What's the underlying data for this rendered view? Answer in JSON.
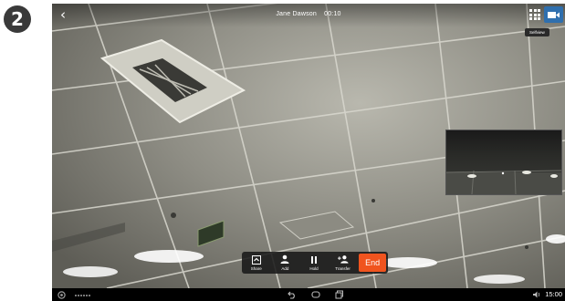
{
  "step": {
    "number": "2"
  },
  "call": {
    "caller_name": "Jane Dawson",
    "duration": "00:10",
    "selfview_tooltip": "Selfview"
  },
  "controls": {
    "share_label": "Share",
    "add_label": "Add",
    "hold_label": "Hold",
    "transfer_label": "Transfer",
    "end_label": "End"
  },
  "status_bar": {
    "time": "15:00"
  },
  "colors": {
    "end_button": "#f0541e",
    "selfview_button": "#2f6fae",
    "nav_bar": "#000000"
  },
  "icons": {
    "back": "chevron-left-icon",
    "dialpad": "dialpad-icon",
    "selfview": "video-camera-icon",
    "share": "share-screen-icon",
    "add": "add-person-icon",
    "hold": "pause-icon",
    "transfer": "transfer-person-icon",
    "nav_back": "nav-back-icon",
    "nav_home": "nav-home-icon",
    "nav_recent": "nav-recent-apps-icon"
  }
}
